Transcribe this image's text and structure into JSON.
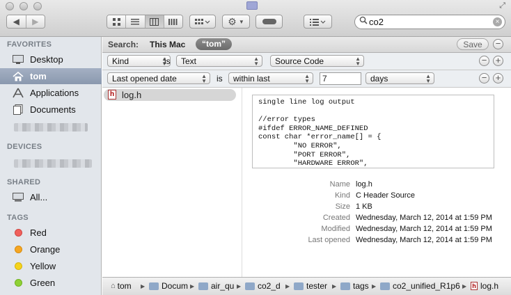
{
  "toolbar": {
    "search_value": "co2"
  },
  "sidebar": {
    "favorites_header": "FAVORITES",
    "favorites": [
      {
        "label": "Desktop",
        "icon": "desktop-icon"
      },
      {
        "label": "tom",
        "icon": "home-icon"
      },
      {
        "label": "Applications",
        "icon": "applications-icon"
      },
      {
        "label": "Documents",
        "icon": "documents-icon"
      }
    ],
    "devices_header": "DEVICES",
    "shared_header": "SHARED",
    "shared": [
      {
        "label": "All...",
        "icon": "network-icon"
      }
    ],
    "tags_header": "TAGS",
    "tags": [
      {
        "label": "Red",
        "color": "#f0605c"
      },
      {
        "label": "Orange",
        "color": "#f5a623"
      },
      {
        "label": "Yellow",
        "color": "#f5d31c"
      },
      {
        "label": "Green",
        "color": "#8fd136"
      }
    ]
  },
  "scope": {
    "search_label": "Search:",
    "this_mac": "This Mac",
    "tom_chip": "“tom”",
    "save_label": "Save"
  },
  "rule1": {
    "attribute": "Kind",
    "operator": "is",
    "value": "Text",
    "subvalue": "Source Code"
  },
  "rule2": {
    "attribute": "Last opened date",
    "operator": "is",
    "condition": "within last",
    "amount": "7",
    "unit": "days"
  },
  "results": {
    "file_name": "log.h"
  },
  "preview": {
    "lines": [
      "single line log output",
      "",
      "//error types",
      "#ifdef ERROR_NAME_DEFINED",
      "const char *error_name[] = {",
      "        \"NO ERROR\",",
      "        \"PORT ERROR\",",
      "        \"HARDWARE ERROR\","
    ]
  },
  "meta": [
    {
      "label": "Name",
      "value": "log.h"
    },
    {
      "label": "Kind",
      "value": "C Header Source"
    },
    {
      "label": "Size",
      "value": "1 KB"
    },
    {
      "label": "Created",
      "value": "Wednesday, March 12, 2014 at 1:59 PM"
    },
    {
      "label": "Modified",
      "value": "Wednesday, March 12, 2014 at 1:59 PM"
    },
    {
      "label": "Last opened",
      "value": "Wednesday, March 12, 2014 at 1:59 PM"
    }
  ],
  "pathbar": [
    {
      "label": "tom"
    },
    {
      "label": "Docum"
    },
    {
      "label": "air_qu"
    },
    {
      "label": "co2_d"
    },
    {
      "label": "tester"
    },
    {
      "label": "tags"
    },
    {
      "label": "co2_unified_R1p6"
    },
    {
      "label": "log.h"
    }
  ]
}
